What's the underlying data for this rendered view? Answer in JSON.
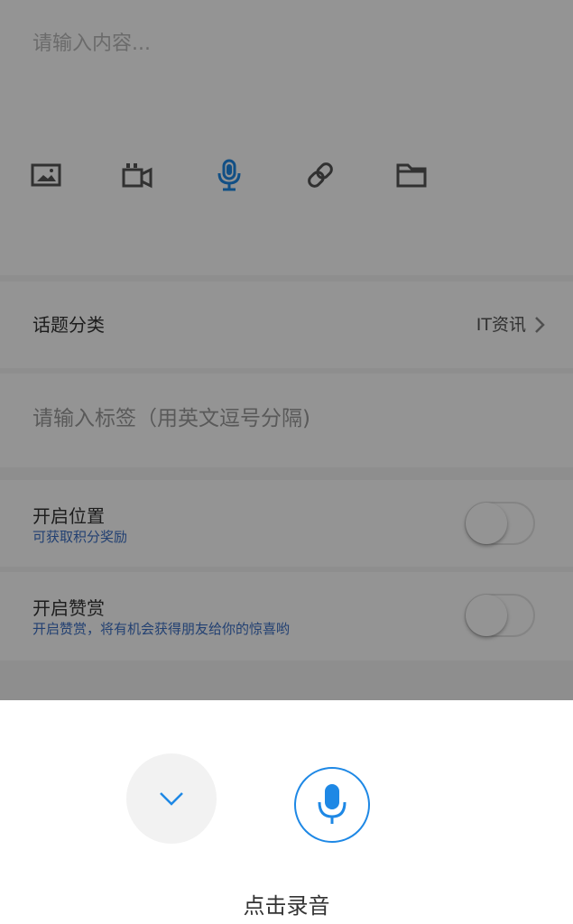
{
  "editor": {
    "content_placeholder": "请输入内容...",
    "tools": [
      {
        "icon": "image-icon"
      },
      {
        "icon": "video-icon"
      },
      {
        "icon": "microphone-icon",
        "active": true
      },
      {
        "icon": "link-icon"
      },
      {
        "icon": "folder-icon"
      }
    ]
  },
  "topic": {
    "label": "话题分类",
    "value": "IT资讯"
  },
  "tags": {
    "placeholder": "请输入标签（用英文逗号分隔)"
  },
  "location": {
    "title": "开启位置",
    "subtitle": "可获取积分奖励",
    "enabled": false
  },
  "reward": {
    "title": "开启赞赏",
    "subtitle": "开启赞赏，将有机会获得朋友给你的惊喜哟",
    "enabled": false
  },
  "recorder": {
    "label": "点击录音"
  },
  "colors": {
    "accent": "#1e88e5",
    "subtitle": "#3b6fc4",
    "icon": "#555555"
  }
}
